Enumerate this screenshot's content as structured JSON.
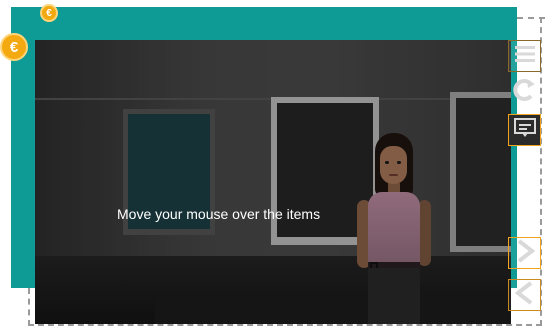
{
  "scene": {
    "instruction": "Move your mouse over the items"
  },
  "badges": {
    "small": "€",
    "large": "€"
  },
  "toolbar": {
    "menu_icon": "hamburger-menu-icon",
    "replay_icon": "replay-icon",
    "caption_icon": "closed-caption-icon",
    "next_icon": "chevron-right-icon",
    "prev_icon": "chevron-left-icon"
  },
  "colors": {
    "teal_frame": "#0f9b95",
    "badge": "#f4a911",
    "toolbar_accent": "#f1a51f"
  }
}
